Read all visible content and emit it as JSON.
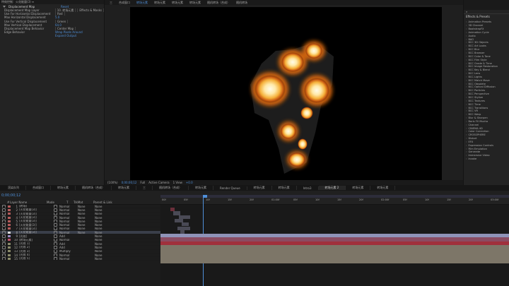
{
  "effect_controls": {
    "tab": "特效控制：火花能量(3) ≡",
    "title": "Displacement Map",
    "reset": "Reset",
    "props": [
      {
        "label": "Displacement Map Layer",
        "value": "10. 转场元素",
        "extra": "Effects & Masks"
      },
      {
        "label": "Use For Horizontal Displacement",
        "value": "Red"
      },
      {
        "label": "Max Horizontal Displacement",
        "value": "5.0"
      },
      {
        "label": "Use For Vertical Displacement",
        "value": "Green"
      },
      {
        "label": "Max Vertical Displacement",
        "value": "64.0"
      },
      {
        "label": "Displacement Map Behavior",
        "value": "Center Map"
      },
      {
        "label": "Edge Behavior",
        "value": "Wrap Pixels Around"
      },
      {
        "label": "",
        "value": "Expand Output"
      }
    ]
  },
  "comp": {
    "tabs": [
      "三",
      "合成窗口",
      "转场元素",
      "转场元素",
      "转场元素",
      "转场元素",
      "随机转场（合成）",
      "随机转场"
    ],
    "active_tab": 2,
    "bottom": [
      "(100%)",
      "0;00;00;12",
      "Full",
      "Active Camera",
      "1 View",
      "+0.0"
    ]
  },
  "effects_panel": {
    "title": "Effects & Presets",
    "items": [
      "Animation Presets",
      "3D Channel",
      "BootstrapFX",
      "Animation Cycle",
      "Audio",
      "BAO",
      "BCC 3D Objects",
      "BCC Art Looks",
      "BCC Blur",
      "BCC Browser",
      "BCC Color & Tone",
      "BCC Film Style",
      "BCC Grade & Time",
      "BCC Image Restoration",
      "BCC Key & Blend",
      "BCC Lens",
      "BCC Lights",
      "BCC Match Move",
      "BCC Obsolete",
      "BCC Optical Diffusion",
      "BCC Particles",
      "BCC Perspective",
      "BCC Stylize",
      "BCC Textures",
      "BCC Time",
      "BCC Transitions",
      "BCC VR",
      "BCC Warp",
      "Blur & Sharpen",
      "Boris FX Mocha",
      "Channel",
      "CINEMA 4D",
      "Color Correction",
      "CROSSPHERE",
      "Distort",
      "EFX",
      "Expression Controls",
      "Film Emulation",
      "Generate",
      "Immersive Video",
      "Invoke"
    ]
  },
  "timeline": {
    "tabs": [
      "渲染队列",
      "合成窗口",
      "转场元素",
      "随机转场（合成）",
      "转场元素",
      "三",
      "随机转场（合成）",
      "转场元素",
      "Render Queue",
      "转场元素",
      "转场元素",
      "Intro3",
      "转场元素 2",
      "转场元素",
      "转场元素"
    ],
    "active_tab": 12,
    "timecode": "0;00;00;12",
    "columns": [
      "#",
      "Layer Name",
      "Mode",
      "T",
      "TrkMat",
      "Parent & Link"
    ],
    "layers": [
      {
        "num": "1",
        "name": "[转场]",
        "mode": "Normal",
        "trk": "None",
        "parent": "None",
        "color": "#b35b5b"
      },
      {
        "num": "2",
        "name": "[火花能量(3)]",
        "mode": "Normal",
        "trk": "None",
        "parent": "None",
        "color": "#b35b5b"
      },
      {
        "num": "3",
        "name": "[火花能量(3)]",
        "mode": "Normal",
        "trk": "None",
        "parent": "None",
        "color": "#b35b5b"
      },
      {
        "num": "4",
        "name": "[火花能量(3)]",
        "mode": "Normal",
        "trk": "None",
        "parent": "None",
        "color": "#b35b5b"
      },
      {
        "num": "5",
        "name": "[火花能量(3)]",
        "mode": "Normal",
        "trk": "None",
        "parent": "None",
        "color": "#b35b5b"
      },
      {
        "num": "6",
        "name": "[火花能量(3)]",
        "mode": "Normal",
        "trk": "None",
        "parent": "None",
        "color": "#b35b5b"
      },
      {
        "num": "7",
        "name": "[火花能量(3)]",
        "mode": "Normal",
        "trk": "None",
        "parent": "None",
        "color": "#b35b5b"
      },
      {
        "num": "8",
        "name": "[火花能量(3)]",
        "mode": "Normal",
        "trk": "None",
        "parent": "None",
        "color": "#d8d8d8"
      },
      {
        "num": "9",
        "name": "[光效]",
        "mode": "Add",
        "trk": "",
        "parent": "None",
        "color": "#9a8abf"
      },
      {
        "num": "10",
        "name": "[转场元素]",
        "mode": "Normal",
        "trk": "",
        "parent": "None",
        "color": "#c0506a"
      },
      {
        "num": "11",
        "name": "[光效 1]",
        "mode": "Add",
        "trk": "",
        "parent": "None",
        "color": "#8a8a6a"
      },
      {
        "num": "12",
        "name": "[光效 2]",
        "mode": "Add",
        "trk": "",
        "parent": "None",
        "color": "#8a8a6a"
      },
      {
        "num": "13",
        "name": "[光效 3]",
        "mode": "Multiply",
        "trk": "",
        "parent": "None",
        "color": "#8a8a6a"
      },
      {
        "num": "14",
        "name": "[光效 4]",
        "mode": "Normal",
        "trk": "",
        "parent": "None",
        "color": "#8a8a6a"
      },
      {
        "num": "15",
        "name": "[光效 5]",
        "mode": "Normal",
        "trk": "",
        "parent": "None",
        "color": "#8a8a6a"
      }
    ],
    "ruler": [
      "00f",
      "05f",
      "10f",
      "15f",
      "20f",
      "01:00f",
      "05f",
      "10f",
      "15f",
      "20f",
      "02:00f",
      "05f",
      "10f",
      "15f",
      "20f",
      "03:00f"
    ]
  }
}
